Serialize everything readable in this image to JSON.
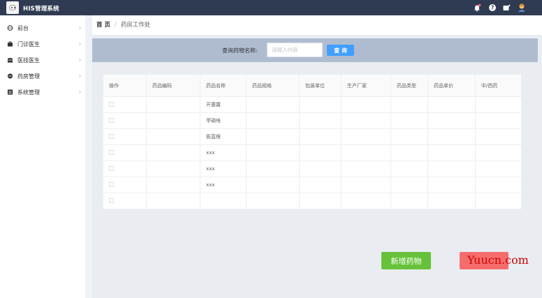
{
  "app": {
    "title": "HIS管理系统"
  },
  "header_icons": [
    "bell-icon",
    "help-icon",
    "mail-icon",
    "user-avatar-icon"
  ],
  "sidebar": {
    "items": [
      {
        "label": "前台",
        "icon": "globe-icon"
      },
      {
        "label": "门诊医生",
        "icon": "briefcase-icon"
      },
      {
        "label": "医技医生",
        "icon": "people-icon"
      },
      {
        "label": "药房管理",
        "icon": "pill-icon"
      },
      {
        "label": "系统管理",
        "icon": "system-icon"
      }
    ],
    "chevron": "›"
  },
  "breadcrumb": {
    "home": "首 页",
    "separator": "/",
    "current": "药房工作处"
  },
  "search": {
    "label": "查询药物名称:",
    "placeholder": "请输入内容",
    "button": "查 询"
  },
  "table": {
    "columns": [
      "操作",
      "药品编码",
      "药品名称",
      "药品规格",
      "包装单位",
      "生产厂家",
      "药品类型",
      "药品单价",
      "中/西药"
    ],
    "rows": [
      [
        "",
        "",
        "开塞露",
        "",
        "",
        "",
        "",
        "",
        ""
      ],
      [
        "",
        "",
        "甲硝唑",
        "",
        "",
        "",
        "",
        "",
        ""
      ],
      [
        "",
        "",
        "板蓝根",
        "",
        "",
        "",
        "",
        "",
        ""
      ],
      [
        "",
        "",
        "xxx",
        "",
        "",
        "",
        "",
        "",
        ""
      ],
      [
        "",
        "",
        "xxx",
        "",
        "",
        "",
        "",
        "",
        ""
      ],
      [
        "",
        "",
        "xxx",
        "",
        "",
        "",
        "",
        "",
        ""
      ],
      [
        "",
        "",
        "",
        "",
        "",
        "",
        "",
        "",
        ""
      ]
    ]
  },
  "actions": {
    "add": "新增药物"
  },
  "watermark": "Yuucn.com",
  "colors": {
    "topbar": "#2f3b52",
    "search_band": "#afbcd0",
    "primary": "#409eff",
    "success": "#67c23a",
    "danger": "#f56c6c"
  }
}
